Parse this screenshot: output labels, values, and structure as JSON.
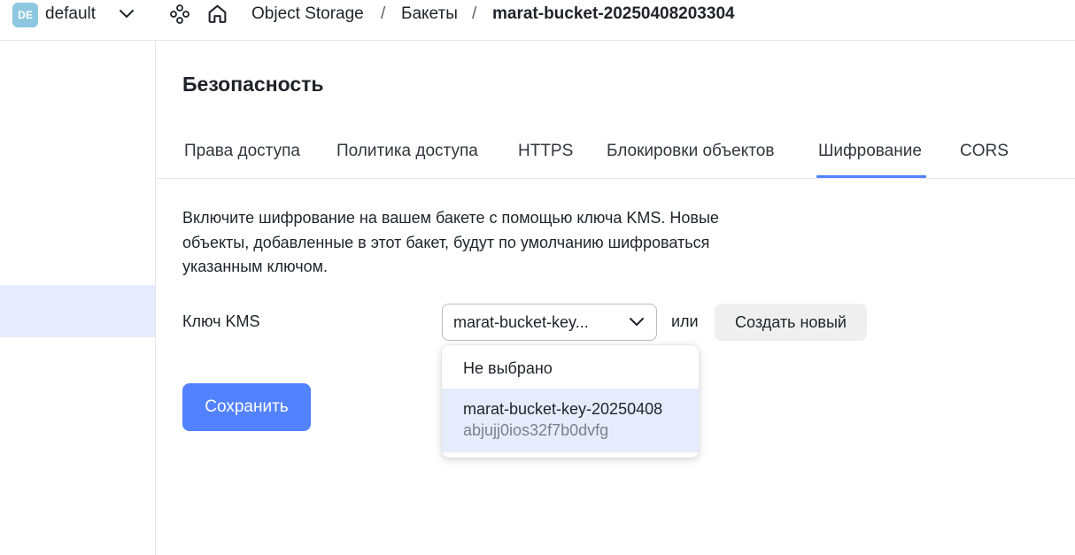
{
  "header": {
    "folder_badge": "DE",
    "folder_name": "default",
    "breadcrumbs": [
      "Object Storage",
      "Бакеты",
      "marat-bucket-20250408203304"
    ],
    "separator": "/"
  },
  "main": {
    "title": "Безопасность",
    "tabs": [
      {
        "label": "Права доступа"
      },
      {
        "label": "Политика доступа"
      },
      {
        "label": "HTTPS"
      },
      {
        "label": "Блокировки объектов"
      },
      {
        "label": "Шифрование",
        "active": true
      },
      {
        "label": "CORS"
      }
    ],
    "description": "Включите шифрование на вашем бакете с помощью ключа KMS. Новые объекты, добавленные в этот бакет, будут по умолчанию шифроваться указанным ключом.",
    "kms_label": "Ключ KMS",
    "kms_selected": "marat-bucket-key...",
    "or_text": "или",
    "create_button": "Создать новый",
    "save_button": "Сохранить"
  },
  "dropdown": {
    "none_option": "Не выбрано",
    "key_option_name": "marat-bucket-key-20250408",
    "key_option_id": "abjujj0ios32f7b0dvfg"
  },
  "colors": {
    "accent": "#5282ff",
    "selected_bg": "#e6ecfb",
    "badge_bg": "#8ec7e0"
  }
}
